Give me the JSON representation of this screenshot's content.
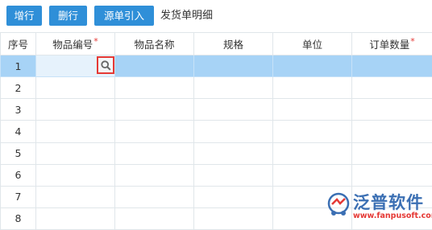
{
  "toolbar": {
    "add_row_label": "增行",
    "delete_row_label": "删行",
    "import_source_label": "源单引入",
    "section_title": "发货单明细"
  },
  "columns": [
    {
      "label": "序号",
      "required": false
    },
    {
      "label": "物品编号",
      "required": true
    },
    {
      "label": "物品名称",
      "required": false
    },
    {
      "label": "规格",
      "required": false
    },
    {
      "label": "单位",
      "required": false
    },
    {
      "label": "订单数量",
      "required": true
    }
  ],
  "required_mark": "*",
  "rows": [
    "1",
    "2",
    "3",
    "4",
    "5",
    "6",
    "7",
    "8"
  ],
  "watermark": {
    "brand": "泛普软件",
    "url": "www.fanpusoft.com"
  },
  "colors": {
    "button": "#2f8fd8",
    "selected_row": "#a7d3f6",
    "highlight_border": "#e53935"
  }
}
